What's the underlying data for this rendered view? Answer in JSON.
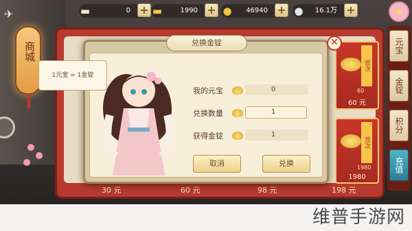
{
  "resources": [
    {
      "icon": "silver-ingot-icon",
      "value": "0",
      "color": "#f1e6c4"
    },
    {
      "icon": "gold-ingot-icon",
      "value": "1990",
      "color": "#f5c64a"
    },
    {
      "icon": "gold-coin-icon",
      "value": "46940",
      "color": "#f2c53a"
    },
    {
      "icon": "silver-coin-icon",
      "value": "16.1万",
      "color": "#dfe6ee"
    }
  ],
  "sign": {
    "text": "商城"
  },
  "tabs": [
    {
      "label": "元宝",
      "active": false
    },
    {
      "label": "金锭",
      "active": false
    },
    {
      "label": "积分",
      "active": false
    },
    {
      "label": "充值",
      "active": true
    }
  ],
  "shop": {
    "bottom_prices": [
      "30 元",
      "60 元",
      "98 元",
      "198 元"
    ],
    "cards": [
      {
        "ribbon": "首次",
        "amount": "60",
        "price": "60 元"
      },
      {
        "ribbon": "首次",
        "amount": "1980",
        "price": "1980"
      }
    ]
  },
  "modal": {
    "title": "兑换金锭",
    "tooltip": "1元宝 = 1金锭",
    "rows": [
      {
        "label": "我的元宝",
        "value": "0"
      },
      {
        "label": "兑换数量",
        "value": "1"
      },
      {
        "label": "获得金锭",
        "value": "1"
      }
    ],
    "cancel_label": "取消",
    "confirm_label": "兑换"
  },
  "watermark": "维普手游网",
  "colors": {
    "accent_red": "#b73a2e",
    "panel_cream": "#f7efd9",
    "tab_active": "#2c7f96"
  }
}
